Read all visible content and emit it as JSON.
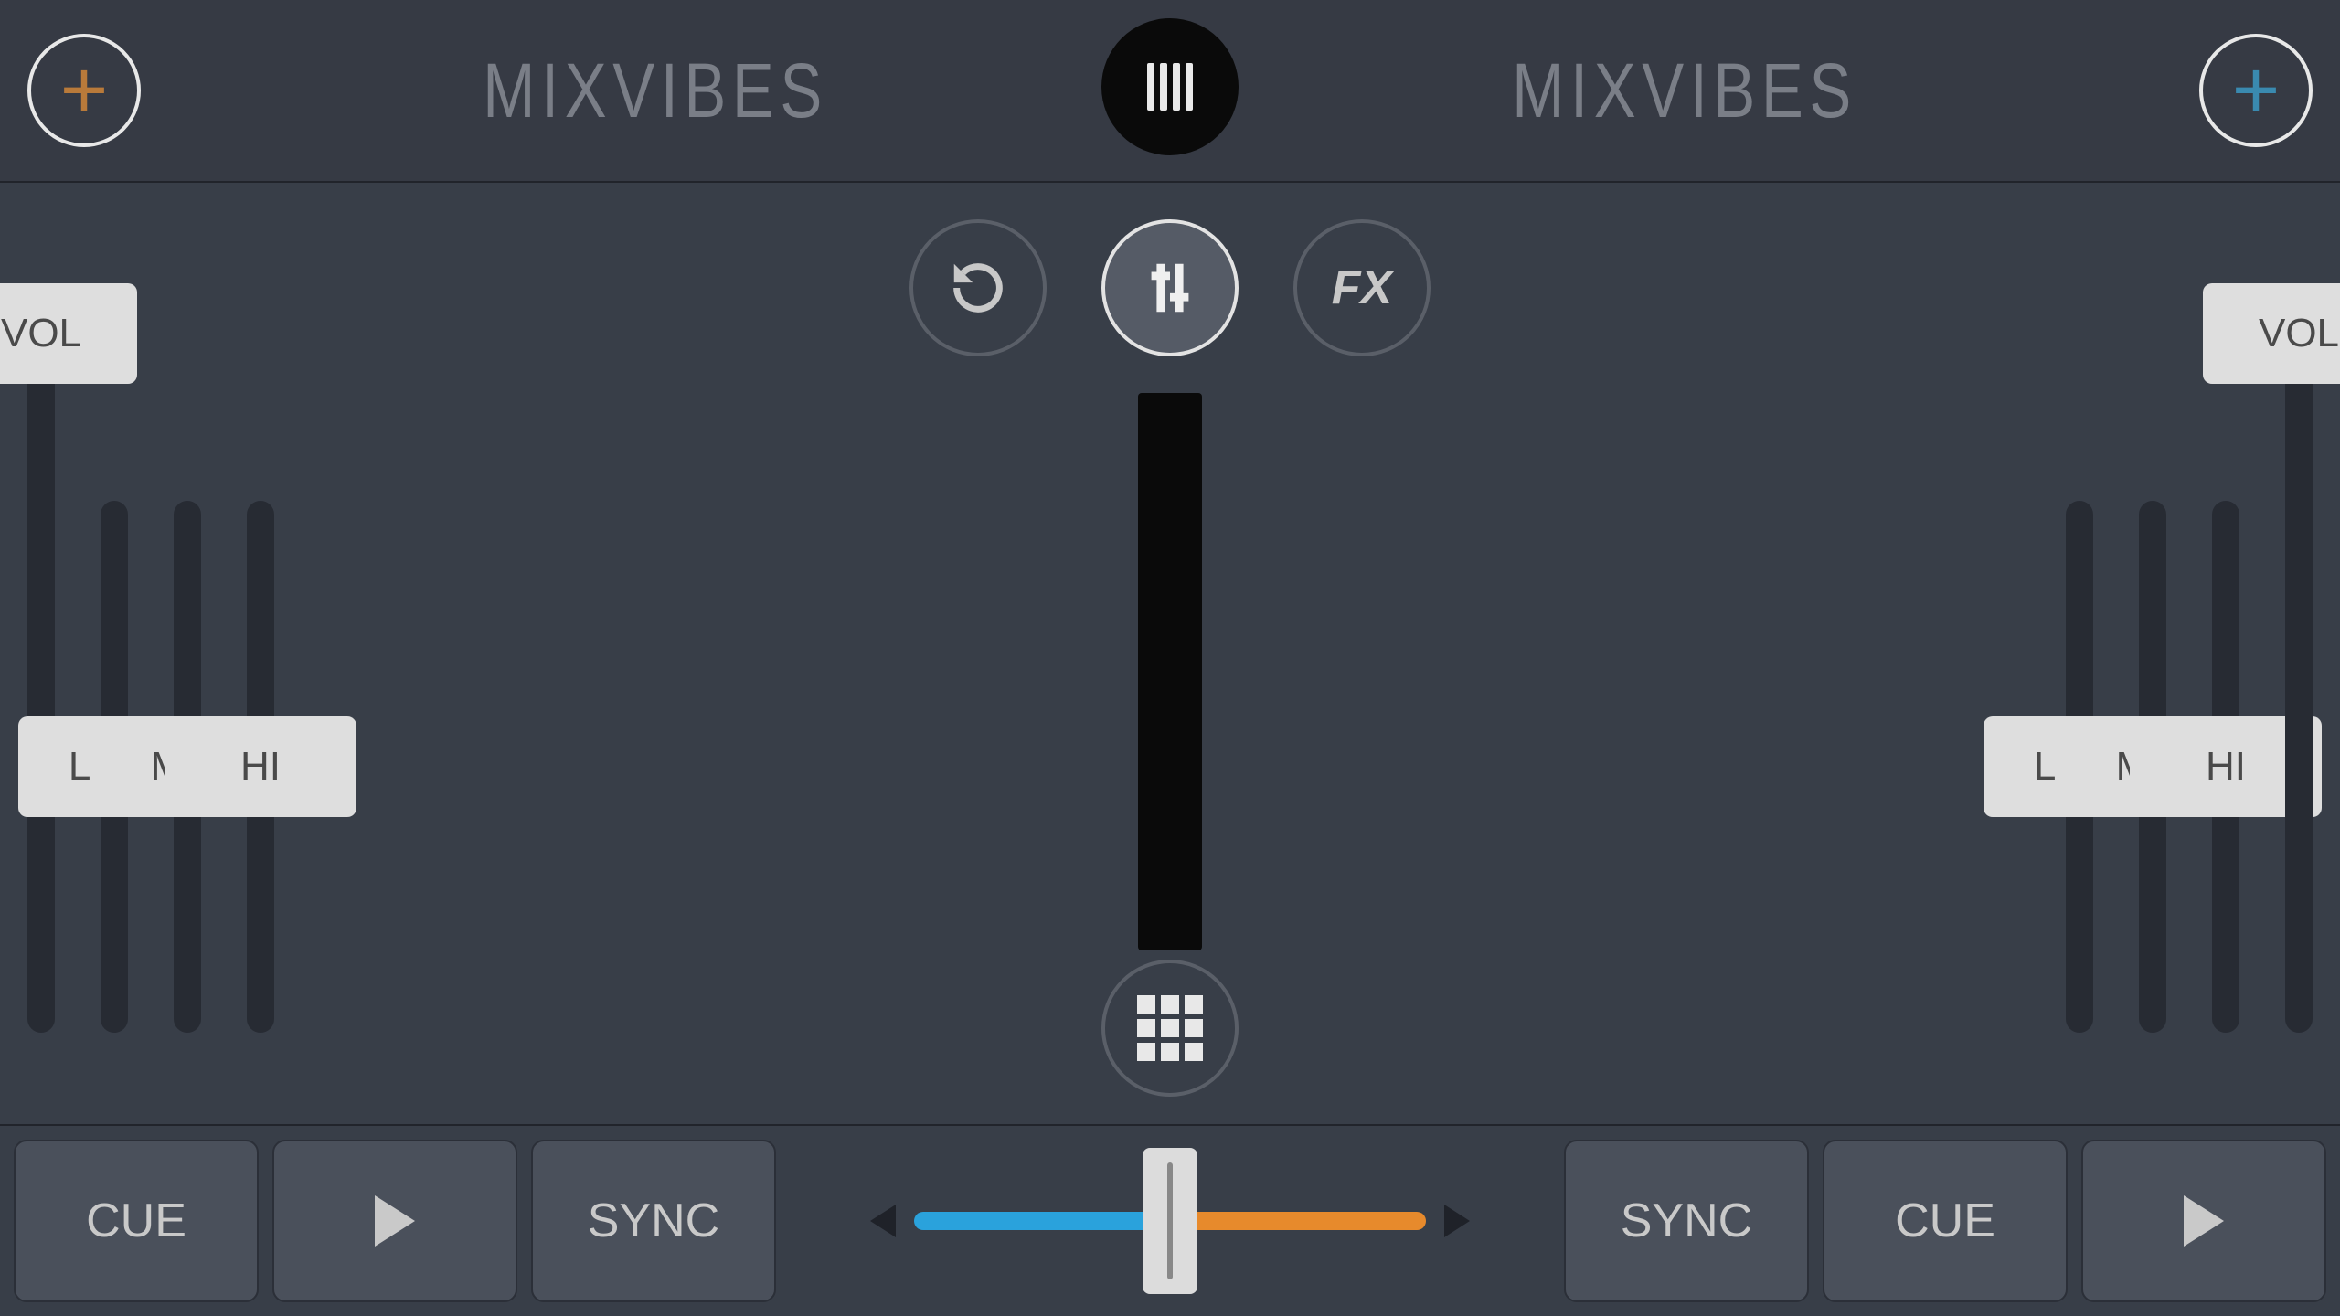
{
  "header": {
    "brand_left": "MIXVIBES",
    "brand_right": "MIXVIBES",
    "add_left_color": "#B97A3A",
    "add_right_color": "#3A8AB0"
  },
  "modes": {
    "loop_icon": "loop",
    "eq_icon": "sliders",
    "fx_label": "FX",
    "active": "eq"
  },
  "deck_a": {
    "vol_label": "VOL",
    "eq": [
      "LOW",
      "MID",
      "HI"
    ]
  },
  "deck_b": {
    "vol_label": "VOL",
    "eq": [
      "LOW",
      "MID",
      "HI"
    ]
  },
  "transport": {
    "deck_a": {
      "cue": "CUE",
      "sync": "SYNC"
    },
    "deck_b": {
      "cue": "CUE",
      "sync": "SYNC"
    },
    "crossfader": {
      "position": 0.5,
      "left_color": "#2AA2DC",
      "right_color": "#E78A2C"
    }
  }
}
